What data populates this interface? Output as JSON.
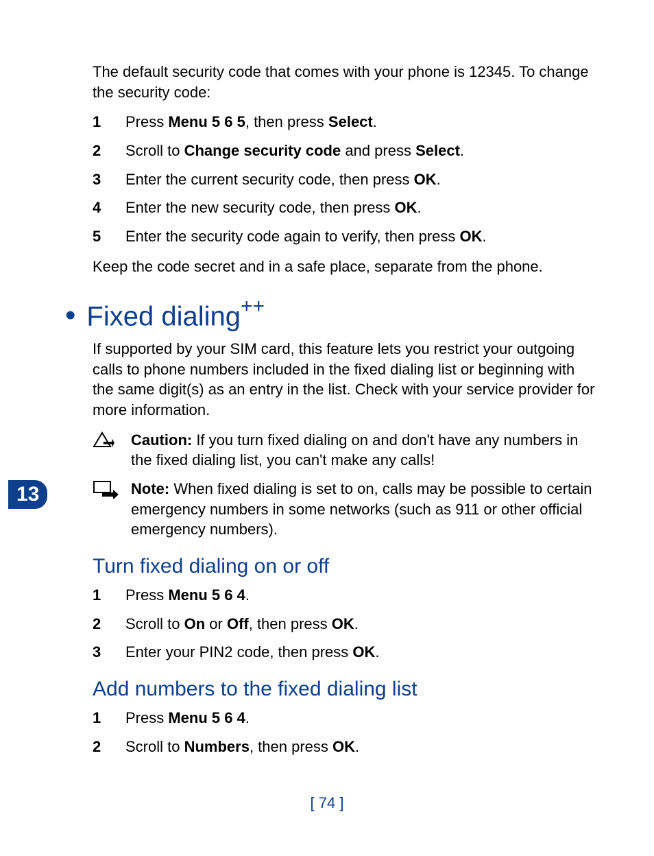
{
  "chapterNumber": "13",
  "pageNumber": "[ 74 ]",
  "intro": "The default security code that comes with your phone is 12345. To change the security code:",
  "steps1": [
    {
      "num": "1",
      "parts": [
        "Press ",
        "Menu 5 6 5",
        ", then press ",
        "Select",
        "."
      ]
    },
    {
      "num": "2",
      "parts": [
        "Scroll to ",
        "Change security code",
        " and press ",
        "Select",
        "."
      ]
    },
    {
      "num": "3",
      "parts": [
        "Enter the current security code, then press ",
        "OK",
        "."
      ]
    },
    {
      "num": "4",
      "parts": [
        "Enter the new security code, then press ",
        "OK",
        "."
      ]
    },
    {
      "num": "5",
      "parts": [
        "Enter the security code again to verify, then press ",
        "OK",
        "."
      ]
    }
  ],
  "afterSteps1": "Keep the code secret and in a safe place, separate from the phone.",
  "h1": "Fixed dialing",
  "h1suffix": "++",
  "h1body": "If supported by your SIM card, this feature lets you restrict your outgoing calls to phone numbers included in the fixed dialing list or beginning with the same digit(s) as an entry in the list. Check with your service provider for more information.",
  "caution": {
    "label": "Caution:",
    "text": " If you turn fixed dialing on and don't have any numbers in the fixed dialing list, you can't make any calls!"
  },
  "note": {
    "label": "Note:",
    "text": " When fixed dialing is set to on, calls may be possible to certain emergency numbers in some networks (such as 911 or other official emergency numbers)."
  },
  "h2a": "Turn fixed dialing on or off",
  "steps2": [
    {
      "num": "1",
      "parts": [
        "Press ",
        "Menu 5 6 4",
        "."
      ]
    },
    {
      "num": "2",
      "parts": [
        "Scroll to ",
        "On",
        " or ",
        "Off",
        ", then press ",
        "OK",
        "."
      ]
    },
    {
      "num": "3",
      "parts": [
        "Enter your PIN2 code, then press ",
        "OK",
        "."
      ]
    }
  ],
  "h2b": "Add numbers to the fixed dialing list",
  "steps3": [
    {
      "num": "1",
      "parts": [
        "Press ",
        "Menu 5 6 4",
        "."
      ]
    },
    {
      "num": "2",
      "parts": [
        "Scroll to ",
        "Numbers",
        ", then press ",
        "OK",
        "."
      ]
    }
  ]
}
